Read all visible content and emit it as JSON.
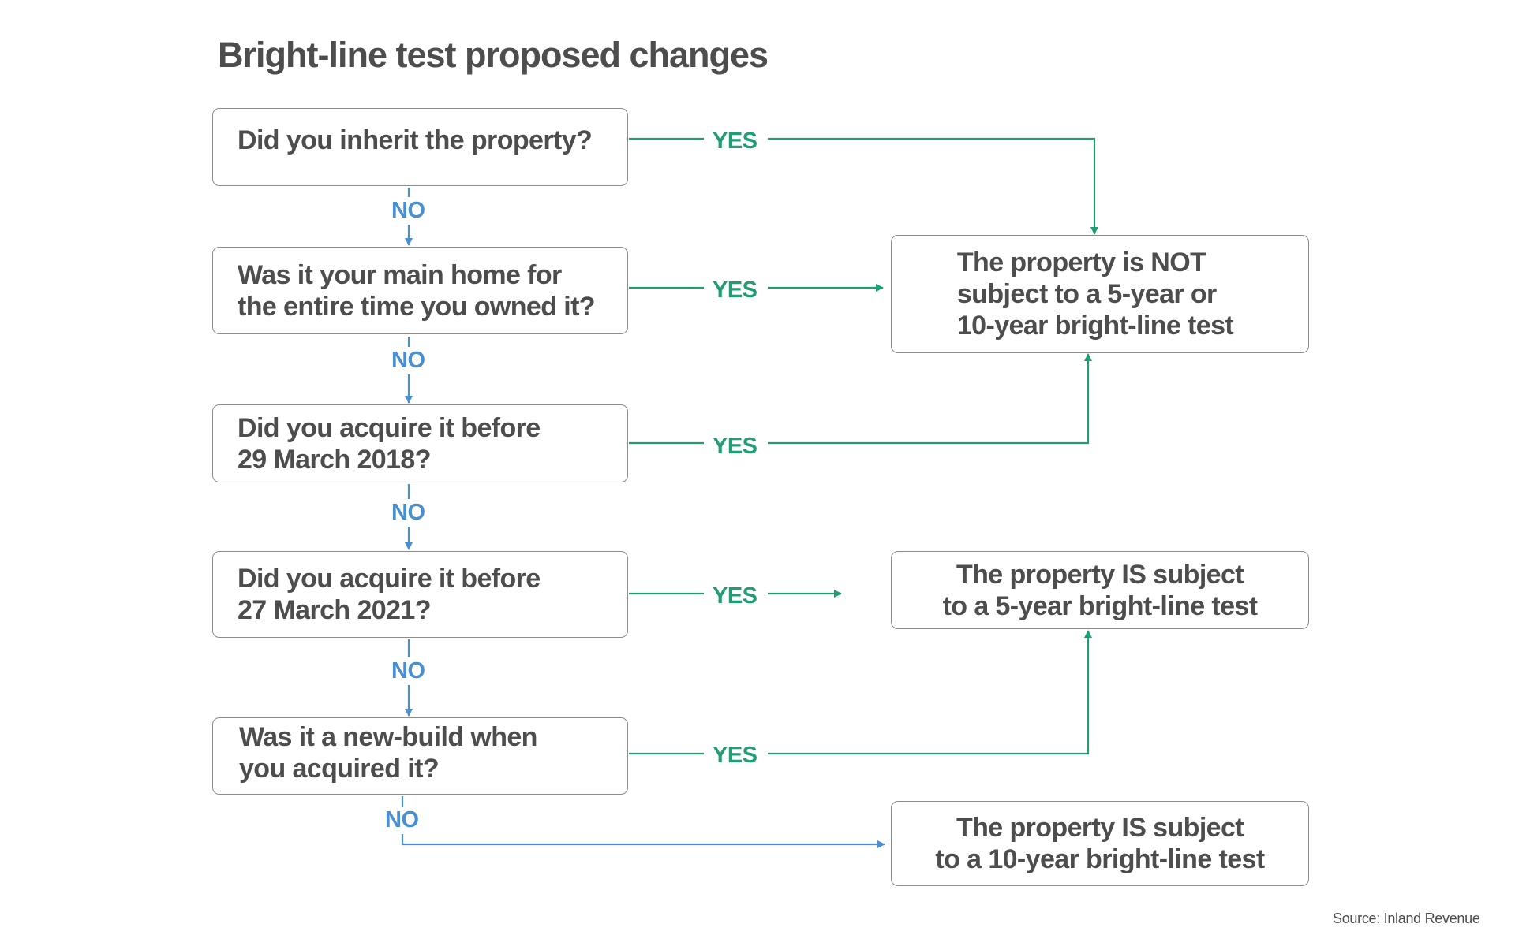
{
  "title": "Bright-line test proposed changes",
  "colors": {
    "yes": "#1f9e74",
    "no": "#4a90d0",
    "text": "#4d4d4d",
    "border": "#8c8c8c"
  },
  "questions": [
    {
      "id": "q1",
      "text": "Did you inherit the property?"
    },
    {
      "id": "q2",
      "text": "Was it your main home for the entire time you owned it?",
      "lines": [
        "Was it your main home for",
        "the entire time you owned it?"
      ]
    },
    {
      "id": "q3",
      "text": "Did you acquire it before 29 March 2018?",
      "lines": [
        "Did you acquire it before",
        "29 March 2018?"
      ]
    },
    {
      "id": "q4",
      "text": "Did you acquire it before 27 March 2021?",
      "lines": [
        "Did you acquire it before",
        "27 March 2021?"
      ]
    },
    {
      "id": "q5",
      "text": "Was it a new-build when you acquired it?",
      "lines": [
        "Was it a new-build when",
        "you acquired it?"
      ]
    }
  ],
  "outcomes": [
    {
      "id": "not_subject",
      "lines": [
        "The property is NOT",
        "subject to a 5-year or",
        "10-year bright-line test"
      ]
    },
    {
      "id": "five_year",
      "lines": [
        "The property IS subject",
        "to a 5-year bright-line test"
      ]
    },
    {
      "id": "ten_year",
      "lines": [
        "The property IS subject",
        "to a 10-year bright-line test"
      ]
    }
  ],
  "edges": [
    {
      "from": "q1",
      "to": "not_subject",
      "label": "YES"
    },
    {
      "from": "q1",
      "to": "q2",
      "label": "NO"
    },
    {
      "from": "q2",
      "to": "not_subject",
      "label": "YES"
    },
    {
      "from": "q2",
      "to": "q3",
      "label": "NO"
    },
    {
      "from": "q3",
      "to": "not_subject",
      "label": "YES"
    },
    {
      "from": "q3",
      "to": "q4",
      "label": "NO"
    },
    {
      "from": "q4",
      "to": "five_year",
      "label": "YES"
    },
    {
      "from": "q4",
      "to": "q5",
      "label": "NO"
    },
    {
      "from": "q5",
      "to": "five_year",
      "label": "YES"
    },
    {
      "from": "q5",
      "to": "ten_year",
      "label": "NO"
    }
  ],
  "labels": {
    "yes": "YES",
    "no": "NO"
  },
  "source": "Source: Inland Revenue"
}
